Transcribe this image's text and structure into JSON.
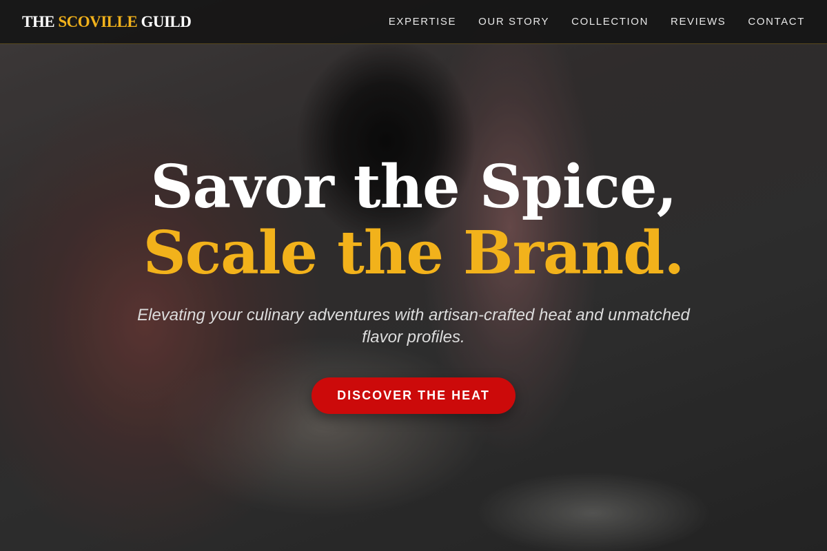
{
  "brand": {
    "logo_prefix": "THE ",
    "logo_accent": "SCOVILLE",
    "logo_suffix": " GUILD",
    "accent_color": "#f2b21b",
    "cta_color": "#cc0a0a"
  },
  "nav": {
    "items": [
      {
        "label": "EXPERTISE"
      },
      {
        "label": "OUR STORY"
      },
      {
        "label": "COLLECTION"
      },
      {
        "label": "REVIEWS"
      },
      {
        "label": "CONTACT"
      }
    ]
  },
  "hero": {
    "headline_line1": "Savor the Spice,",
    "headline_line2": "Scale the Brand.",
    "subtitle": "Elevating your culinary adventures with artisan-crafted heat and unmatched flavor profiles.",
    "cta_label": "DISCOVER THE HEAT"
  }
}
